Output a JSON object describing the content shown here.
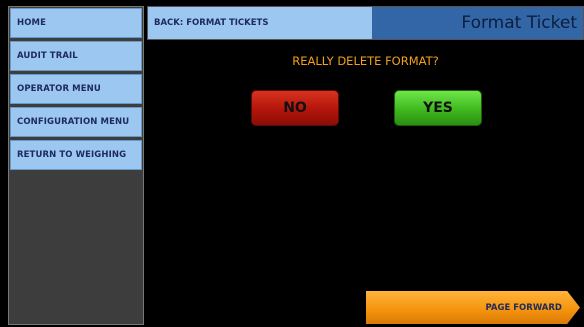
{
  "sidebar": {
    "items": [
      {
        "label": "HOME"
      },
      {
        "label": "AUDIT TRAIL"
      },
      {
        "label": "OPERATOR MENU"
      },
      {
        "label": "CONFIGURATION MENU"
      },
      {
        "label": "RETURN TO WEIGHING"
      }
    ]
  },
  "header": {
    "back_label": "BACK: FORMAT TICKETS",
    "title": "Format Ticket"
  },
  "dialog": {
    "prompt": "REALLY DELETE FORMAT?",
    "no_label": "NO",
    "yes_label": "YES"
  },
  "footer": {
    "page_forward_label": "PAGE FORWARD"
  },
  "colors": {
    "sidebar_button": "#9cc7f1",
    "title_bar": "#3266a7",
    "prompt_text": "#f1a21c",
    "no_button": "#c0200f",
    "yes_button": "#46c021",
    "page_forward": "#f4920c"
  }
}
